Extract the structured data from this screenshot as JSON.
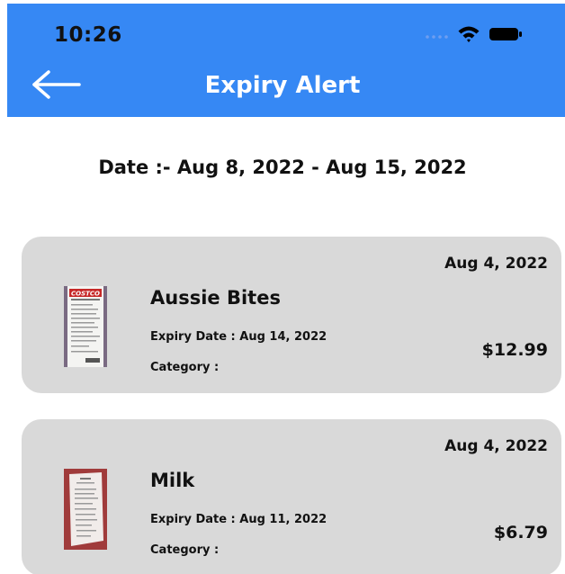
{
  "status_bar": {
    "time": "10:26"
  },
  "header": {
    "title": "Expiry Alert",
    "background": "#3688f4"
  },
  "date_range": "Date :- Aug 8, 2022 - Aug 15, 2022",
  "items": [
    {
      "date": "Aug 4, 2022",
      "name": "Aussie Bites",
      "expiry": "Expiry Date : Aug 14, 2022",
      "category": "Category :",
      "price": "$12.99",
      "receipt_store": "COSTCO"
    },
    {
      "date": "Aug 4, 2022",
      "name": "Milk",
      "expiry": "Expiry Date : Aug 11, 2022",
      "category": "Category :",
      "price": "$6.79"
    }
  ],
  "colors": {
    "card_background": "#d9d9d9",
    "accent": "#3688f4"
  },
  "icons": [
    "back-arrow-icon",
    "wifi-icon",
    "battery-icon",
    "signal-dots-icon"
  ]
}
